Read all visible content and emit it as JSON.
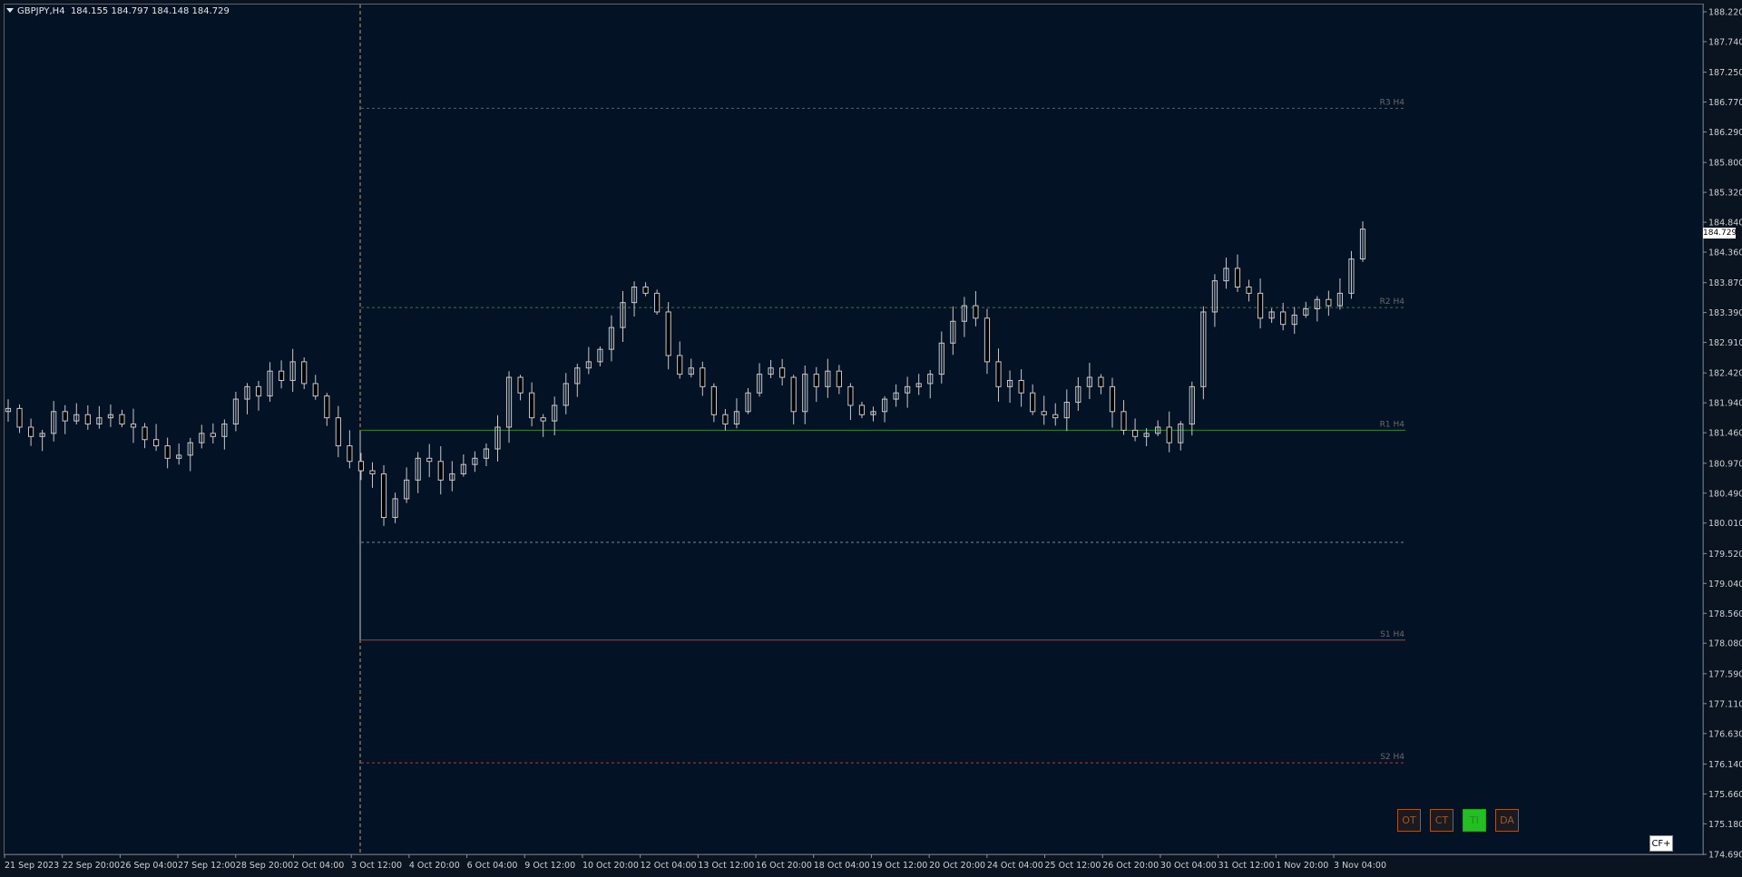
{
  "header": {
    "symbol": "GBPJPY,H4",
    "ohlc": "184.155 184.797 184.148 184.729"
  },
  "price_axis": {
    "ticks": [
      "188.220",
      "187.740",
      "187.250",
      "186.770",
      "186.290",
      "185.800",
      "185.320",
      "184.840",
      "184.360",
      "183.870",
      "183.390",
      "182.910",
      "182.420",
      "181.940",
      "181.460",
      "180.970",
      "180.490",
      "180.010",
      "179.520",
      "179.040",
      "178.560",
      "178.080",
      "177.590",
      "177.110",
      "176.630",
      "176.140",
      "175.660",
      "175.180",
      "174.690"
    ],
    "current_price_label": "184.729"
  },
  "time_axis": {
    "labels": [
      "21 Sep 2023",
      "22 Sep 20:00",
      "26 Sep 04:00",
      "27 Sep 12:00",
      "28 Sep 20:00",
      "2 Oct 04:00",
      "3 Oct 12:00",
      "4 Oct 20:00",
      "6 Oct 04:00",
      "9 Oct 12:00",
      "10 Oct 20:00",
      "12 Oct 04:00",
      "13 Oct 12:00",
      "16 Oct 20:00",
      "18 Oct 04:00",
      "19 Oct 12:00",
      "20 Oct 20:00",
      "24 Oct 04:00",
      "25 Oct 12:00",
      "26 Oct 20:00",
      "30 Oct 04:00",
      "31 Oct 12:00",
      "1 Nov 20:00",
      "3 Nov 04:00"
    ]
  },
  "levels": [
    {
      "label": "R3 H4",
      "price": 186.67,
      "color": "#3d7a3d",
      "style": "dotted"
    },
    {
      "label": "R2 H4",
      "price": 183.47,
      "color": "#3d7a3d",
      "style": "dotted"
    },
    {
      "label": "R1 H4",
      "price": 181.5,
      "color": "#2f8a2f",
      "style": "solid"
    },
    {
      "label": "",
      "price": 179.7,
      "color": "#7a8aa0",
      "style": "dotted"
    },
    {
      "label": "S1 H4",
      "price": 178.13,
      "color": "#c83232",
      "style": "solid"
    },
    {
      "label": "S2 H4",
      "price": 176.16,
      "color": "#c83232",
      "style": "dotted"
    }
  ],
  "buttons": [
    {
      "label": "OT",
      "active": false
    },
    {
      "label": "CT",
      "active": false
    },
    {
      "label": "TI",
      "active": true
    },
    {
      "label": "DA",
      "active": false
    }
  ],
  "cf_button": "CF+",
  "colors": {
    "background": "#031224",
    "candle": "#c8c8c8",
    "axis_text": "#d0d0d0",
    "vline": "#c8a060"
  },
  "chart_data": {
    "type": "candlestick",
    "x_range": [
      "21 Sep 2023",
      "3 Nov 04:00"
    ],
    "y_range": [
      174.69,
      188.22
    ],
    "close_path": [
      181.85,
      181.55,
      181.4,
      181.45,
      181.8,
      181.65,
      181.75,
      181.6,
      181.7,
      181.75,
      181.6,
      181.55,
      181.35,
      181.25,
      181.05,
      181.1,
      181.3,
      181.45,
      181.4,
      181.6,
      182.0,
      182.2,
      182.05,
      182.45,
      182.3,
      182.6,
      182.25,
      182.05,
      181.7,
      181.25,
      181.0,
      180.85,
      180.8,
      180.1,
      180.4,
      180.7,
      181.05,
      181.0,
      180.7,
      180.8,
      180.95,
      181.05,
      181.2,
      181.55,
      182.35,
      182.1,
      181.7,
      181.65,
      181.9,
      182.25,
      182.5,
      182.6,
      182.8,
      183.15,
      183.55,
      183.8,
      183.7,
      183.4,
      182.7,
      182.4,
      182.5,
      182.2,
      181.75,
      181.6,
      181.8,
      182.1,
      182.4,
      182.5,
      182.35,
      181.8,
      182.4,
      182.2,
      182.45,
      182.2,
      181.9,
      181.75,
      181.8,
      182.0,
      182.1,
      182.2,
      182.25,
      182.4,
      182.9,
      183.25,
      183.5,
      183.3,
      182.6,
      182.2,
      182.3,
      182.1,
      181.8,
      181.75,
      181.7,
      181.95,
      182.2,
      182.35,
      182.2,
      181.8,
      181.5,
      181.4,
      181.45,
      181.55,
      181.3,
      181.6,
      182.2,
      183.4,
      183.9,
      184.1,
      183.8,
      183.7,
      183.3,
      183.4,
      183.2,
      183.35,
      183.45,
      183.6,
      183.5,
      183.7,
      184.25,
      184.73
    ]
  }
}
